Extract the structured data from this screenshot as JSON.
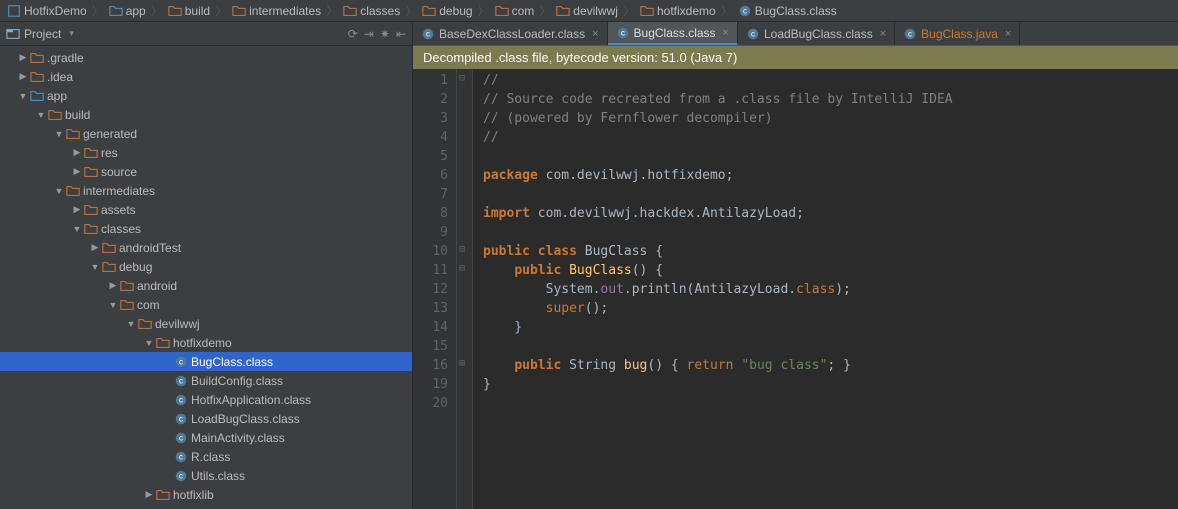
{
  "breadcrumb": [
    {
      "icon": "project",
      "label": "HotfixDemo"
    },
    {
      "icon": "module",
      "label": "app"
    },
    {
      "icon": "folder",
      "label": "build"
    },
    {
      "icon": "folder",
      "label": "intermediates"
    },
    {
      "icon": "folder",
      "label": "classes"
    },
    {
      "icon": "folder",
      "label": "debug"
    },
    {
      "icon": "folder",
      "label": "com"
    },
    {
      "icon": "folder",
      "label": "devilwwj"
    },
    {
      "icon": "folder",
      "label": "hotfixdemo"
    },
    {
      "icon": "class",
      "label": "BugClass.class"
    }
  ],
  "sidebar": {
    "title": "Project",
    "tree": [
      {
        "d": 0,
        "a": "r",
        "i": "folder",
        "t": ".gradle"
      },
      {
        "d": 0,
        "a": "r",
        "i": "folder",
        "t": ".idea"
      },
      {
        "d": 0,
        "a": "d",
        "i": "module",
        "t": "app"
      },
      {
        "d": 1,
        "a": "d",
        "i": "folder",
        "t": "build"
      },
      {
        "d": 2,
        "a": "d",
        "i": "folder",
        "t": "generated"
      },
      {
        "d": 3,
        "a": "r",
        "i": "folder",
        "t": "res"
      },
      {
        "d": 3,
        "a": "r",
        "i": "folder",
        "t": "source"
      },
      {
        "d": 2,
        "a": "d",
        "i": "folder",
        "t": "intermediates"
      },
      {
        "d": 3,
        "a": "r",
        "i": "folder",
        "t": "assets"
      },
      {
        "d": 3,
        "a": "d",
        "i": "folder",
        "t": "classes"
      },
      {
        "d": 4,
        "a": "r",
        "i": "folder",
        "t": "androidTest"
      },
      {
        "d": 4,
        "a": "d",
        "i": "folder",
        "t": "debug"
      },
      {
        "d": 5,
        "a": "r",
        "i": "folder",
        "t": "android"
      },
      {
        "d": 5,
        "a": "d",
        "i": "folder",
        "t": "com"
      },
      {
        "d": 6,
        "a": "d",
        "i": "folder",
        "t": "devilwwj"
      },
      {
        "d": 7,
        "a": "d",
        "i": "folder",
        "t": "hotfixdemo"
      },
      {
        "d": 8,
        "a": "",
        "i": "class",
        "t": "BugClass.class",
        "sel": true
      },
      {
        "d": 8,
        "a": "",
        "i": "class",
        "t": "BuildConfig.class"
      },
      {
        "d": 8,
        "a": "",
        "i": "class",
        "t": "HotfixApplication.class"
      },
      {
        "d": 8,
        "a": "",
        "i": "class",
        "t": "LoadBugClass.class"
      },
      {
        "d": 8,
        "a": "",
        "i": "class",
        "t": "MainActivity.class"
      },
      {
        "d": 8,
        "a": "",
        "i": "class",
        "t": "R.class"
      },
      {
        "d": 8,
        "a": "",
        "i": "class",
        "t": "Utils.class"
      },
      {
        "d": 7,
        "a": "r",
        "i": "folder",
        "t": "hotfixlib"
      }
    ]
  },
  "tabs": [
    {
      "i": "class",
      "t": "BaseDexClassLoader.class",
      "act": false
    },
    {
      "i": "class",
      "t": "BugClass.class",
      "act": true
    },
    {
      "i": "class",
      "t": "LoadBugClass.class",
      "act": false
    },
    {
      "i": "java",
      "t": "BugClass.java",
      "act": false,
      "warn": true
    }
  ],
  "banner": "Decompiled .class file, bytecode version: 51.0 (Java 7)",
  "gutter": [
    "1",
    "2",
    "3",
    "4",
    "5",
    "6",
    "7",
    "8",
    "9",
    "10",
    "11",
    "12",
    "13",
    "14",
    "15",
    "16",
    "19",
    "20"
  ],
  "code": {
    "l1": "//",
    "l2": "// Source code recreated from a .class file by IntelliJ IDEA",
    "l3": "// (powered by Fernflower decompiler)",
    "l4": "//",
    "l6a": "package ",
    "l6b": "com.devilwwj.hotfixdemo",
    "l8a": "import ",
    "l8b": "com.devilwwj.hackdex.AntilazyLoad",
    "l10a": "public class ",
    "l10b": "BugClass",
    "l11a": "public ",
    "l11b": "BugClass",
    "l12a": "System.",
    "l12b": "out",
    "l12c": ".println(AntilazyLoad.",
    "l12d": "class",
    "l12e": ");",
    "l13": "super",
    "l16a": "public ",
    "l16b": "String ",
    "l16c": "bug",
    "l16d": "() {",
    "l16e": " return ",
    "l16f": "\"bug class\"",
    "l16g": "; }"
  }
}
